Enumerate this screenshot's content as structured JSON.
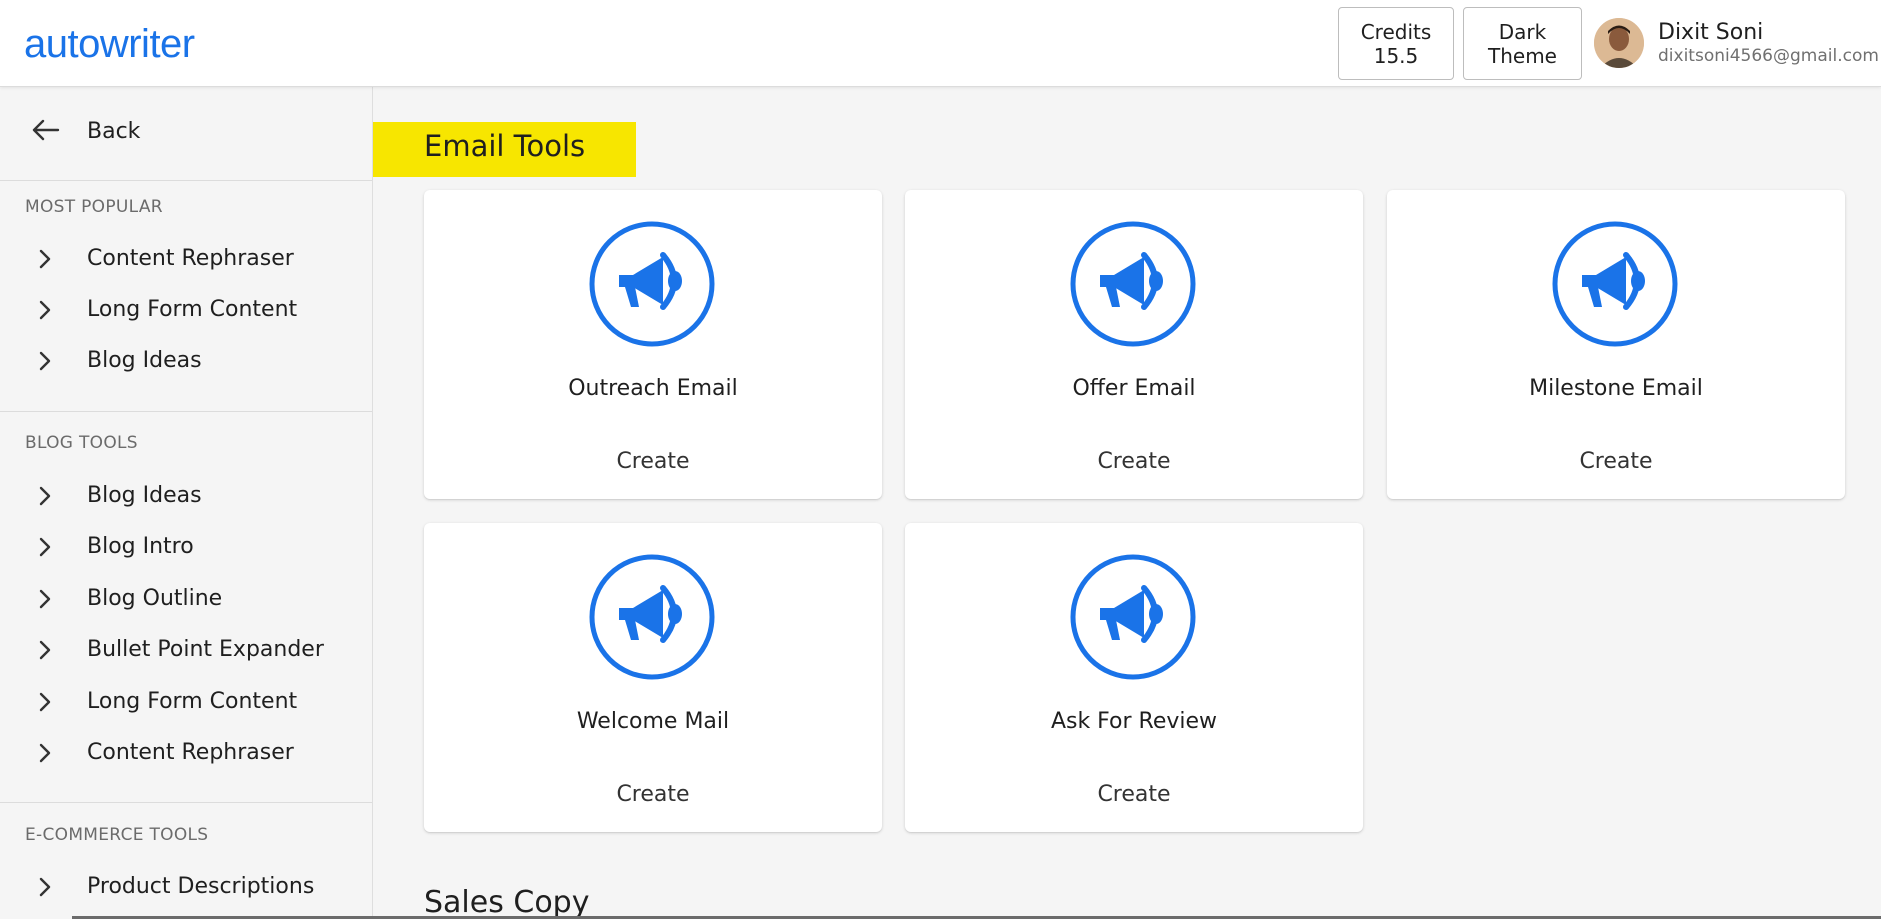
{
  "header": {
    "logo": "autowriter",
    "credits_label": "Credits",
    "credits_value": "15.5",
    "theme_label_line1": "Dark",
    "theme_label_line2": "Theme",
    "user_name": "Dixit Soni",
    "user_email": "dixitsoni4566@gmail.com"
  },
  "sidebar": {
    "back_label": "Back",
    "sections": [
      {
        "title": "MOST POPULAR",
        "items": [
          "Content Rephraser",
          "Long Form Content",
          "Blog Ideas"
        ]
      },
      {
        "title": "BLOG TOOLS",
        "items": [
          "Blog Ideas",
          "Blog Intro",
          "Blog Outline",
          "Bullet Point Expander",
          "Long Form Content",
          "Content Rephraser"
        ]
      },
      {
        "title": "E-COMMERCE TOOLS",
        "items": [
          "Product Descriptions"
        ]
      }
    ]
  },
  "main": {
    "section_title": "Email Tools",
    "cards": [
      {
        "title": "Outreach Email",
        "action": "Create",
        "icon": "megaphone-icon"
      },
      {
        "title": "Offer Email",
        "action": "Create",
        "icon": "megaphone-icon"
      },
      {
        "title": "Milestone Email",
        "action": "Create",
        "icon": "megaphone-icon"
      },
      {
        "title": "Welcome Mail",
        "action": "Create",
        "icon": "megaphone-icon"
      },
      {
        "title": "Ask For Review",
        "action": "Create",
        "icon": "megaphone-icon"
      }
    ],
    "next_section_title": "Sales Copy"
  },
  "colors": {
    "brand": "#1a73e8",
    "highlight": "#f7e600"
  }
}
